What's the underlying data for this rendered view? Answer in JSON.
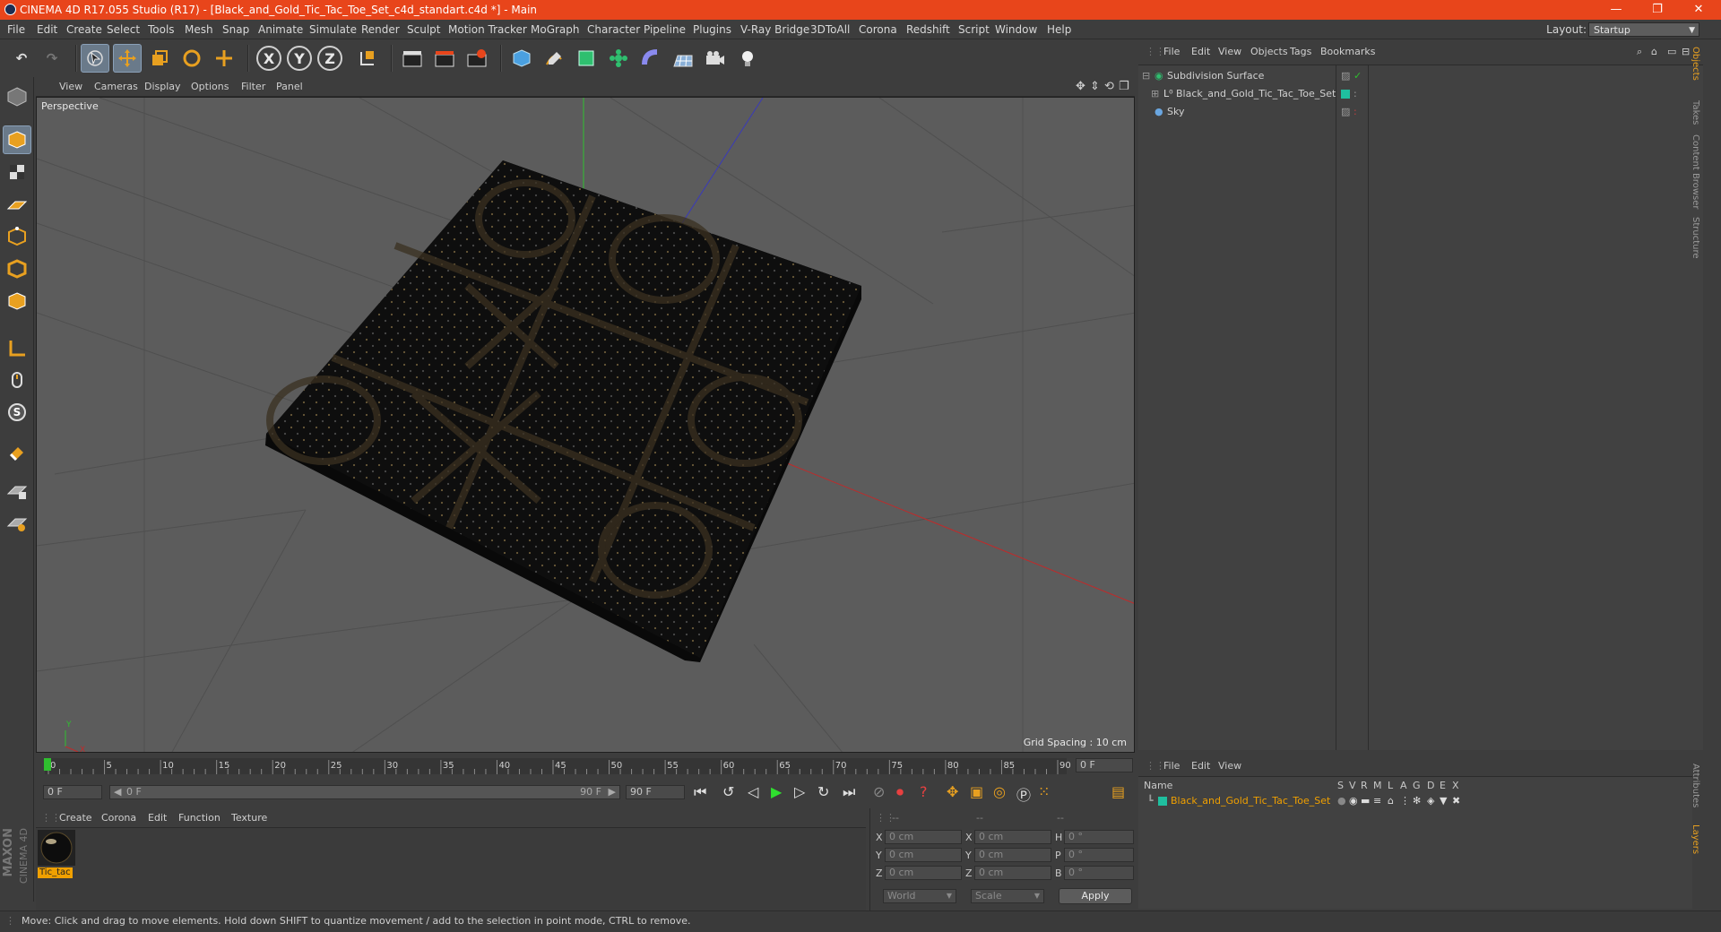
{
  "titlebar": {
    "title": "CINEMA 4D R17.055 Studio (R17) - [Black_and_Gold_Tic_Tac_Toe_Set_c4d_standart.c4d *] - Main",
    "minimize": "—",
    "restore": "❐",
    "close": "✕"
  },
  "menubar": {
    "items": [
      "File",
      "Edit",
      "Create",
      "Select",
      "Tools",
      "Mesh",
      "Snap",
      "Animate",
      "Simulate",
      "Render",
      "Sculpt",
      "Motion Tracker",
      "MoGraph",
      "Character",
      "Pipeline",
      "Plugins",
      "V-Ray Bridge",
      "3DToAll",
      "Corona",
      "Redshift",
      "Script",
      "Window",
      "Help"
    ],
    "layout_label": "Layout:",
    "layout_value": "Startup"
  },
  "toolbar": {
    "undo": "↶",
    "redo": "↷",
    "axis_x": "X",
    "axis_y": "Y",
    "axis_z": "Z"
  },
  "viewport": {
    "menu": [
      "View",
      "Cameras",
      "Display",
      "Options",
      "Filter",
      "Panel"
    ],
    "camera_label": "Perspective",
    "grid_spacing": "Grid Spacing : 10 cm",
    "axis_y": "Y",
    "axis_x": "X"
  },
  "object_manager": {
    "menu": [
      "File",
      "Edit",
      "View",
      "Objects",
      "Tags",
      "Bookmarks"
    ],
    "objects": [
      {
        "name": "Subdivision Surface",
        "color": "#c8c8c8"
      },
      {
        "name": "Black_and_Gold_Tic_Tac_Toe_Set",
        "color": "#c8c8c8"
      },
      {
        "name": "Sky",
        "color": "#c8c8c8"
      }
    ],
    "side_tabs": [
      "Objects",
      "Takes",
      "Content Browser",
      "Structure"
    ]
  },
  "timeline": {
    "ticks": [
      "0",
      "5",
      "10",
      "15",
      "20",
      "25",
      "30",
      "35",
      "40",
      "45",
      "50",
      "55",
      "60",
      "65",
      "70",
      "75",
      "80",
      "85",
      "90"
    ],
    "frame_end_field": "0 F",
    "start_field": "0 F",
    "range_start": "0 F",
    "range_end": "90 F",
    "end_field": "90 F"
  },
  "material_manager": {
    "menu": [
      "Create",
      "Corona",
      "Edit",
      "Function",
      "Texture"
    ],
    "material_name": "Tic_tac"
  },
  "coordinates": {
    "header": [
      "--",
      "--",
      "--"
    ],
    "rows": [
      {
        "a": "X",
        "av": "0 cm",
        "b": "X",
        "bv": "0 cm",
        "c": "H",
        "cv": "0 °"
      },
      {
        "a": "Y",
        "av": "0 cm",
        "b": "Y",
        "bv": "0 cm",
        "c": "P",
        "cv": "0 °"
      },
      {
        "a": "Z",
        "av": "0 cm",
        "b": "Z",
        "bv": "0 cm",
        "c": "B",
        "cv": "0 °"
      }
    ],
    "world": "World",
    "scale": "Scale",
    "apply": "Apply"
  },
  "layer_manager": {
    "menu": [
      "File",
      "Edit",
      "View"
    ],
    "col_name": "Name",
    "cols": [
      "S",
      "V",
      "R",
      "M",
      "L",
      "A",
      "G",
      "D",
      "E",
      "X"
    ],
    "layer_name": "Black_and_Gold_Tic_Tac_Toe_Set",
    "side_tabs": [
      "Attributes",
      "Layers"
    ]
  },
  "branding": {
    "maxon": "MAXON",
    "c4d": "CINEMA 4D"
  },
  "status": "Move: Click and drag to move elements. Hold down SHIFT to quantize movement / add to the selection in point mode, CTRL to remove.",
  "colors": {
    "accent": "#e8451b",
    "layer_name": "#f0a000",
    "teal": "#1fbf9f"
  }
}
